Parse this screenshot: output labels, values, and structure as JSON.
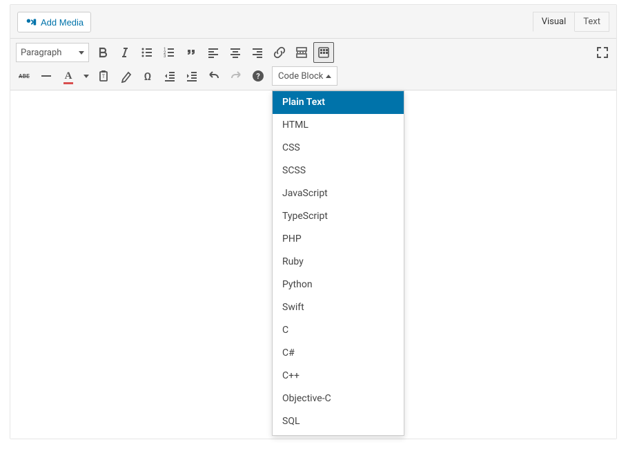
{
  "media_button": {
    "label": "Add Media"
  },
  "tabs": {
    "visual": "Visual",
    "text": "Text"
  },
  "format_select": {
    "value": "Paragraph"
  },
  "code_block": {
    "label": "Code Block"
  },
  "dropdown": {
    "selected": "Plain Text",
    "items": [
      "Plain Text",
      "HTML",
      "CSS",
      "SCSS",
      "JavaScript",
      "TypeScript",
      "PHP",
      "Ruby",
      "Python",
      "Swift",
      "C",
      "C#",
      "C++",
      "Objective-C",
      "SQL"
    ]
  },
  "icons": {
    "bold": "bold-icon",
    "italic": "italic-icon",
    "ul": "bulleted-list-icon",
    "ol": "numbered-list-icon",
    "quote": "blockquote-icon",
    "align_left": "align-left-icon",
    "align_center": "align-center-icon",
    "align_right": "align-right-icon",
    "link": "link-icon",
    "readmore": "read-more-icon",
    "toolbar_toggle": "toolbar-toggle-icon",
    "fullscreen": "fullscreen-icon",
    "strike": "strikethrough-icon",
    "hr": "horizontal-rule-icon",
    "textcolor": "text-color-icon",
    "paste": "paste-icon",
    "clear": "clear-formatting-icon",
    "specialchar": "special-character-icon",
    "outdent": "outdent-icon",
    "indent": "indent-icon",
    "undo": "undo-icon",
    "redo": "redo-icon",
    "help": "help-icon"
  }
}
